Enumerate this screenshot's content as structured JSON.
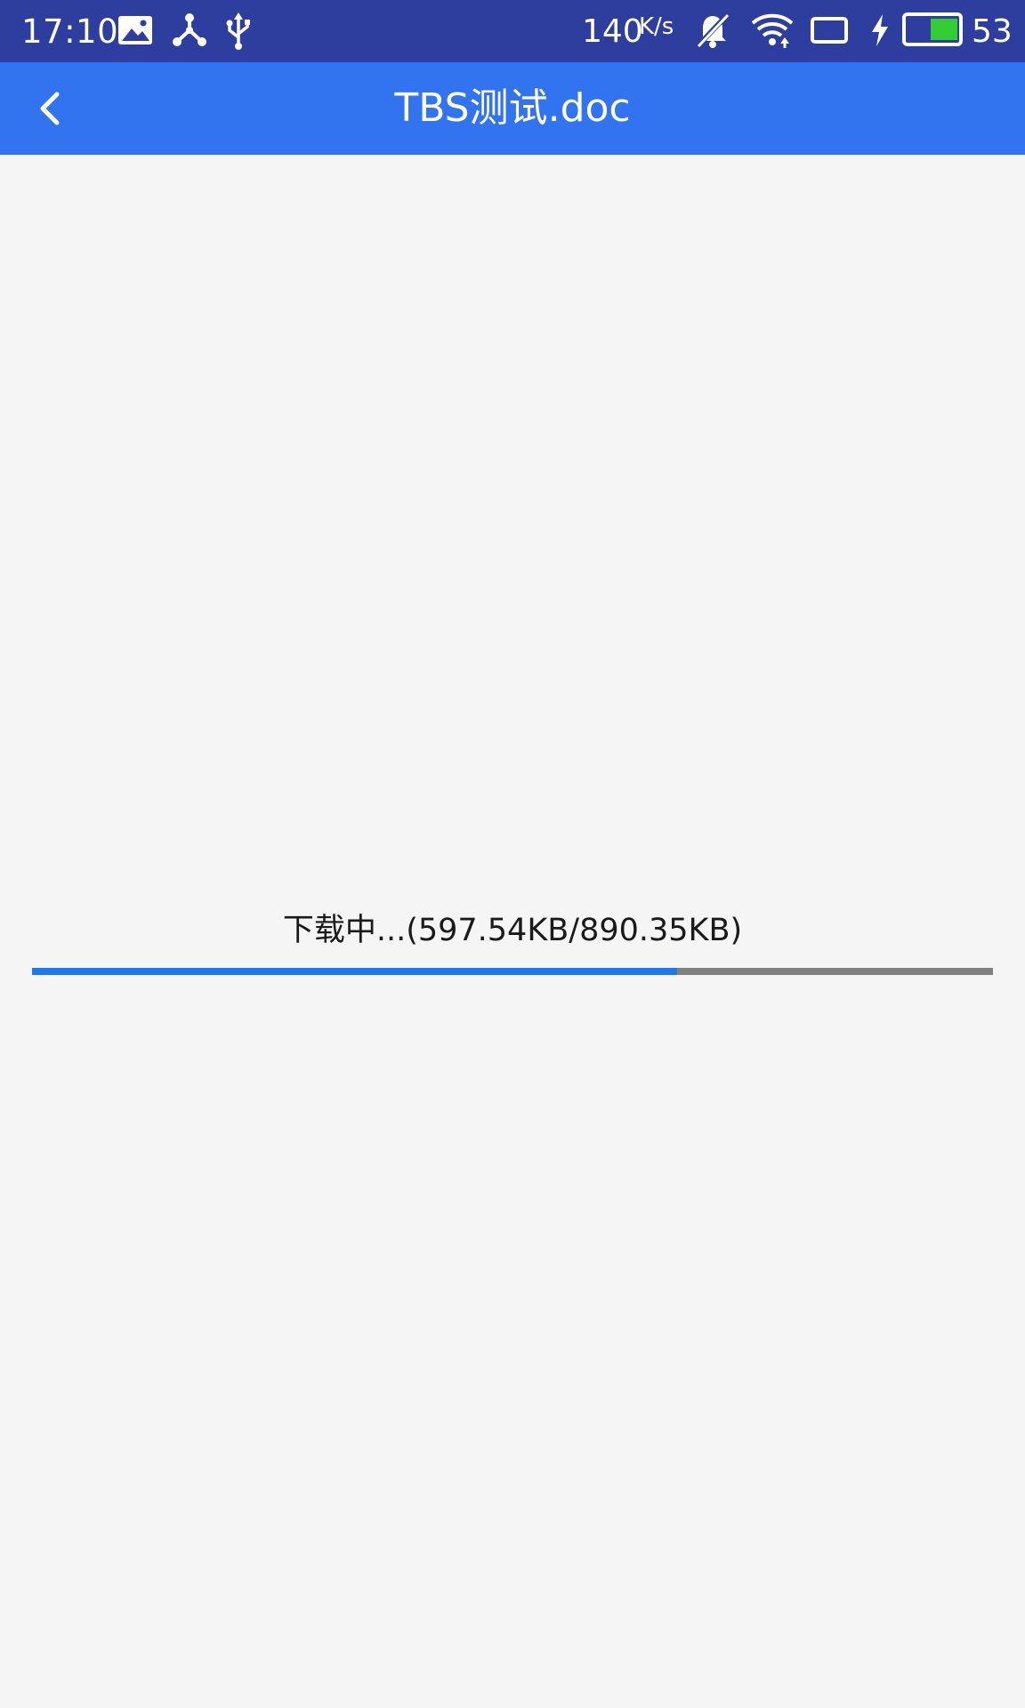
{
  "status_bar": {
    "time": "17:10",
    "network_speed": "140",
    "network_speed_unit": "K/s",
    "battery_percent": "53",
    "icons": [
      "gallery-icon",
      "share-icon",
      "usb-icon",
      "bell-muted-icon",
      "wifi-icon",
      "screen-icon",
      "charging-icon",
      "battery-icon"
    ],
    "battery_color": "#33cc33"
  },
  "app_bar": {
    "title": "TBS测试.doc",
    "back_icon": "chevron-left-icon",
    "background": "#3273f0"
  },
  "download": {
    "status_text": "下载中...(597.54KB/890.35KB)",
    "downloaded_kb": 597.54,
    "total_kb": 890.35,
    "progress_fraction": 0.671,
    "progress_color": "#1e78f0",
    "track_color": "#808080"
  }
}
